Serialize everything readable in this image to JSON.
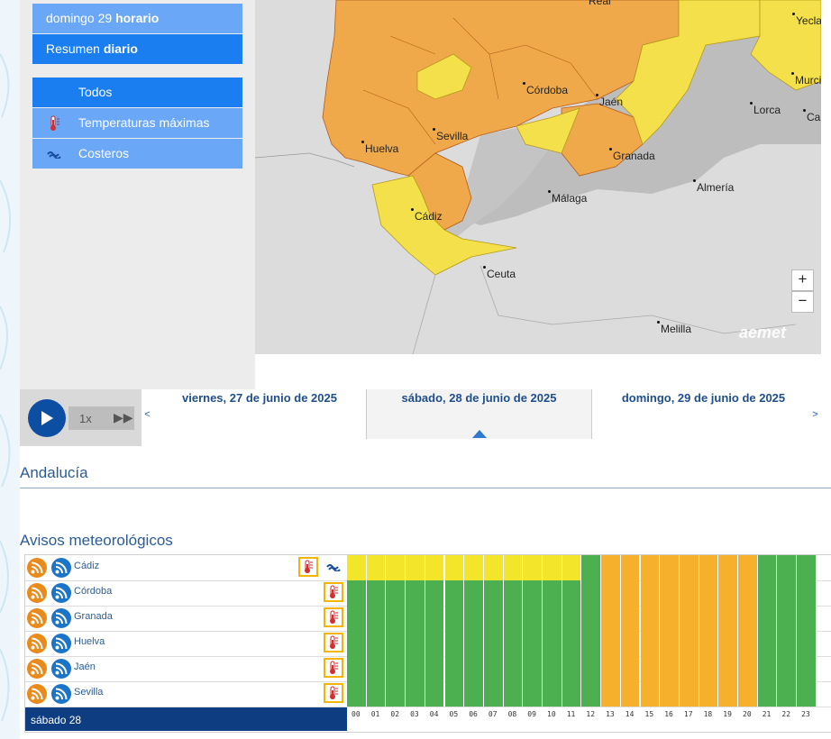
{
  "sidebar": {
    "date_item_prefix": "domingo 29",
    "date_item_bold": "horario",
    "summary_prefix": "Resumen",
    "summary_bold": "diario",
    "filters": [
      {
        "label": "Todos",
        "icon": ""
      },
      {
        "label": "Temperaturas máximas",
        "icon": "thermometer-icon"
      },
      {
        "label": "Costeros",
        "icon": "coastal-wave-icon"
      }
    ]
  },
  "map": {
    "cities": [
      "Real",
      "Yecla",
      "Murci",
      "Córdoba",
      "Jaén",
      "Lorca",
      "Ca",
      "Sevilla",
      "Huelva",
      "Granada",
      "Almería",
      "Málaga",
      "Cádiz",
      "Ceuta",
      "Melilla"
    ],
    "zoom_in": "+",
    "zoom_out": "−",
    "logo": "aemet",
    "colors": {
      "orange": "#f0a94a",
      "yellow": "#f3e04a",
      "grey": "#bdbdbd",
      "sea": "#dcdcdc"
    }
  },
  "timeline": {
    "speed": "1x",
    "prev": "<",
    "next": ">",
    "days": [
      "viernes, 27 de junio de 2025",
      "sábado, 28 de junio de 2025",
      "domingo, 29 de junio de 2025"
    ],
    "selected_index": 1
  },
  "region_title": "Andalucía",
  "warnings_title": "Avisos meteorológicos",
  "warnings_table": {
    "provinces": [
      {
        "name": "Cádiz",
        "icons": [
          "thermometer-icon",
          "coastal-wave-icon"
        ],
        "hours": [
          "y",
          "y",
          "y",
          "y",
          "y",
          "y",
          "y",
          "y",
          "y",
          "y",
          "y",
          "y",
          "g",
          "o",
          "o",
          "o",
          "o",
          "o",
          "o",
          "o",
          "o",
          "g",
          "g",
          "g"
        ]
      },
      {
        "name": "Córdoba",
        "icons": [
          "thermometer-icon"
        ],
        "hours": [
          "g",
          "g",
          "g",
          "g",
          "g",
          "g",
          "g",
          "g",
          "g",
          "g",
          "g",
          "g",
          "g",
          "o",
          "o",
          "o",
          "o",
          "o",
          "o",
          "o",
          "o",
          "g",
          "g",
          "g"
        ]
      },
      {
        "name": "Granada",
        "icons": [
          "thermometer-icon"
        ],
        "hours": [
          "g",
          "g",
          "g",
          "g",
          "g",
          "g",
          "g",
          "g",
          "g",
          "g",
          "g",
          "g",
          "g",
          "o",
          "o",
          "o",
          "o",
          "o",
          "o",
          "o",
          "o",
          "g",
          "g",
          "g"
        ]
      },
      {
        "name": "Huelva",
        "icons": [
          "thermometer-icon"
        ],
        "hours": [
          "g",
          "g",
          "g",
          "g",
          "g",
          "g",
          "g",
          "g",
          "g",
          "g",
          "g",
          "g",
          "g",
          "o",
          "o",
          "o",
          "o",
          "o",
          "o",
          "o",
          "o",
          "g",
          "g",
          "g"
        ]
      },
      {
        "name": "Jaén",
        "icons": [
          "thermometer-icon"
        ],
        "hours": [
          "g",
          "g",
          "g",
          "g",
          "g",
          "g",
          "g",
          "g",
          "g",
          "g",
          "g",
          "g",
          "g",
          "o",
          "o",
          "o",
          "o",
          "o",
          "o",
          "o",
          "o",
          "g",
          "g",
          "g"
        ]
      },
      {
        "name": "Sevilla",
        "icons": [
          "thermometer-icon"
        ],
        "hours": [
          "g",
          "g",
          "g",
          "g",
          "g",
          "g",
          "g",
          "g",
          "g",
          "g",
          "g",
          "g",
          "g",
          "o",
          "o",
          "o",
          "o",
          "o",
          "o",
          "o",
          "o",
          "g",
          "g",
          "g"
        ]
      }
    ],
    "level_colors": {
      "g": "#4caf50",
      "y": "#f2e52a",
      "o": "#f6b02c"
    },
    "footer_date": "sábado 28",
    "hour_labels": [
      "00",
      "01",
      "02",
      "03",
      "04",
      "05",
      "06",
      "07",
      "08",
      "09",
      "10",
      "11",
      "12",
      "13",
      "14",
      "15",
      "16",
      "17",
      "18",
      "19",
      "20",
      "21",
      "22",
      "23"
    ]
  }
}
